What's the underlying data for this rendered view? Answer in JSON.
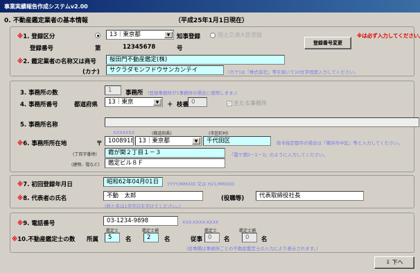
{
  "window": {
    "title": "事業実績報告作成システムv2.00"
  },
  "header": {
    "section_title": "0. 不動産鑑定業者の基本情報",
    "date_text": "（平成25年1月1日現在）"
  },
  "required_note": "※は必ず入力してください。",
  "reg_change_button": "登録番号変更",
  "sec1": {
    "reg_type_label": "登録区分",
    "pref_select": "13｜東京都",
    "chiji_label": "知事登録",
    "minister_label": "国土交通大臣登録",
    "reg_no_label": "登録番号",
    "dai": "第",
    "reg_no": "12345678",
    "go": "号",
    "name_label": "鑑定業者の名称又は商号",
    "name_value": "桜田門不動産鑑定(株)",
    "kana_label": "(カナ)",
    "kana_value": "サクラダモンフドウサンカンテイ",
    "kana_hint": "(カナ)は『株式会社』等を除いて10文字程度入力してください。"
  },
  "sec2": {
    "office_count_label": "3. 事務所の数",
    "office_count": "1",
    "office_unit": "事務所",
    "office_count_note": "(登録事務所が1事務所の場合に使用します。)",
    "office_no_label": "4. 事務所番号",
    "pref_label": "都道府県",
    "pref_value": "13｜東京",
    "plus": "＋",
    "branch_label": "枝番",
    "branch_value": "0",
    "main_office_label": "主たる事務所",
    "office_name_label": "5. 事務所名称",
    "office_name_value": "",
    "zip_hint": "XXXXXXX",
    "pref_hint": "(都道府県)",
    "city_hint": "(市区町村)",
    "addr_label": "6. 事務所所在地",
    "zip_mark": "〒",
    "zip_value": "1008918",
    "addr_pref": "13｜東京都",
    "addr_city": "千代田区",
    "addr_city_note": "政令指定都市の場合は『横浜市中区』等と入力してください。",
    "street_label": "(丁目字番地)",
    "street_value": "霞が関２丁目１－３",
    "street_note": "『霞ケ関2－1－3』のように入力してください。",
    "bldg_label": "(建物、階など)",
    "bldg_value": "鑑定ビル８Ｆ"
  },
  "sec3": {
    "reg_date_label": "7. 初回登録年月日",
    "reg_date_value": "昭和62年04月01日",
    "reg_date_hint": "YYYY/MM/DD 又は H21/MM/DD",
    "rep_label": "8. 代表者の氏名",
    "rep_value": "不動　太郎",
    "rep_note": "(姓と名は1字空白を空けてください。)",
    "title_label": "(役職等)",
    "title_value": "代表取締役社長"
  },
  "sec4": {
    "phone_label": "9. 電話番号",
    "phone_value": "03-1234-9898",
    "phone_hint": "XXX-XXXX-XXXX",
    "appraiser_label": "10.不動産鑑定士の数",
    "shozoku": "所属",
    "juji": "従事",
    "mei": "名",
    "kanteishi": "鑑定士",
    "kanteishiho": "鑑定士補",
    "shozoku_kanteishi": "5",
    "shozoku_ho": "2",
    "juji_kanteishi": "0",
    "juji_ho": "0",
    "juji_note": "(従事欄は事務所ごとの不動産鑑定士の入力により表示されます。)"
  },
  "next_button": "下へ"
}
